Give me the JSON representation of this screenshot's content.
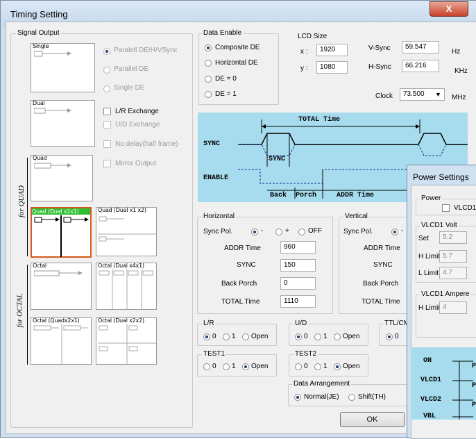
{
  "window": {
    "title": "Timing Setting",
    "close_label": "X"
  },
  "signal_output": {
    "group_label": "Signal Output",
    "cards": [
      {
        "label": "Single"
      },
      {
        "label": "Dual"
      },
      {
        "label": "Quad"
      },
      {
        "label": "Quad (Dual x2x1)"
      },
      {
        "label": "Quad (Dual x1 x2)"
      },
      {
        "label": "Octal"
      },
      {
        "label": "Octal (Dual x4x1)"
      },
      {
        "label": "Octal (Quadx2x1)"
      },
      {
        "label": "Octal (Dual x2x2)"
      }
    ],
    "quad_side_label": "for QUAD",
    "octal_side_label": "for OCTAL",
    "options": {
      "paralell_dehv": "Paralell DE/H/VSync",
      "parallel_de": "Parallel DE",
      "single_de": "Single DE",
      "lr_exchange": "L/R Exchange",
      "ud_exchange": "U/D Exchange",
      "no_delay": "No delay(half frame)",
      "mirror_output": "Mirror Output"
    }
  },
  "data_enable": {
    "group_label": "Data Enable",
    "options": [
      "Composite DE",
      "Horizontal DE",
      "DE = 0",
      "DE = 1"
    ]
  },
  "lcd_size": {
    "label": "LCD Size",
    "x_label": "x :",
    "x": "1920",
    "y_label": "y :",
    "y": "1080"
  },
  "sync": {
    "vsync_label": "V-Sync",
    "vsync": "59.547",
    "vsync_unit": "Hz",
    "hsync_label": "H-Sync",
    "hsync": "66.216",
    "hsync_unit": "KHz",
    "clock_label": "Clock",
    "clock": "73.500",
    "clock_unit": "MHz"
  },
  "diagram": {
    "total_time": "TOTAL Time",
    "sync_label": "SYNC",
    "sync_box": "SYNC",
    "enable": "ENABLE",
    "back": "Back",
    "porch": "Porch",
    "addr_time": "ADDR Time"
  },
  "horizontal": {
    "group_label": "Horizontal",
    "sync_pol_label": "Sync Pol.",
    "pol_minus": "-",
    "pol_plus": "+",
    "pol_off": "OFF",
    "addr_label": "ADDR Time",
    "addr": "960",
    "sync_lbl": "SYNC",
    "sync": "150",
    "back_porch_label": "Back Porch",
    "back_porch": "0",
    "total_label": "TOTAL Time",
    "total": "1110"
  },
  "vertical": {
    "group_label": "Vertical",
    "sync_pol_label": "Sync Pol.",
    "pol_minus": "-",
    "addr_label": "ADDR Time",
    "sync_lbl": "SYNC",
    "back_porch_label": "Back Porch",
    "total_label": "TOTAL Time"
  },
  "lr": {
    "group_label": "L/R",
    "o0": "0",
    "o1": "1",
    "open": "Open"
  },
  "ud": {
    "group_label": "U/D",
    "o0": "0",
    "o1": "1",
    "open": "Open"
  },
  "ttl": {
    "group_label": "TTL/CM",
    "o0": "0"
  },
  "test1": {
    "group_label": "TEST1",
    "o0": "0",
    "o1": "1",
    "open": "Open"
  },
  "test2": {
    "group_label": "TEST2",
    "o0": "0",
    "o1": "1",
    "open": "Open"
  },
  "data_arrangement": {
    "group_label": "Data Arrangement",
    "normal": "Normal(JE)",
    "shift": "Shift(TH)"
  },
  "ok_label": "OK",
  "power": {
    "title": "Power Settings",
    "power_group": "Power",
    "vlcd_check": "VLCD1",
    "vlcd1_volt_group": "VLCD1 Volt",
    "set_label": "Set",
    "set": "5.2",
    "hlimit_label": "H Limit",
    "hlimit": "5.7",
    "llimit_label": "L Limit",
    "llimit": "4.7",
    "vlcd1_ampere_group": "VLCD1 Ampere",
    "amp_hlimit_label": "H Limit",
    "amp_hlimit": "4",
    "diagram_labels": [
      "ON",
      "VLCD1",
      "VLCD2",
      "VBL"
    ],
    "pin_label": "P"
  }
}
